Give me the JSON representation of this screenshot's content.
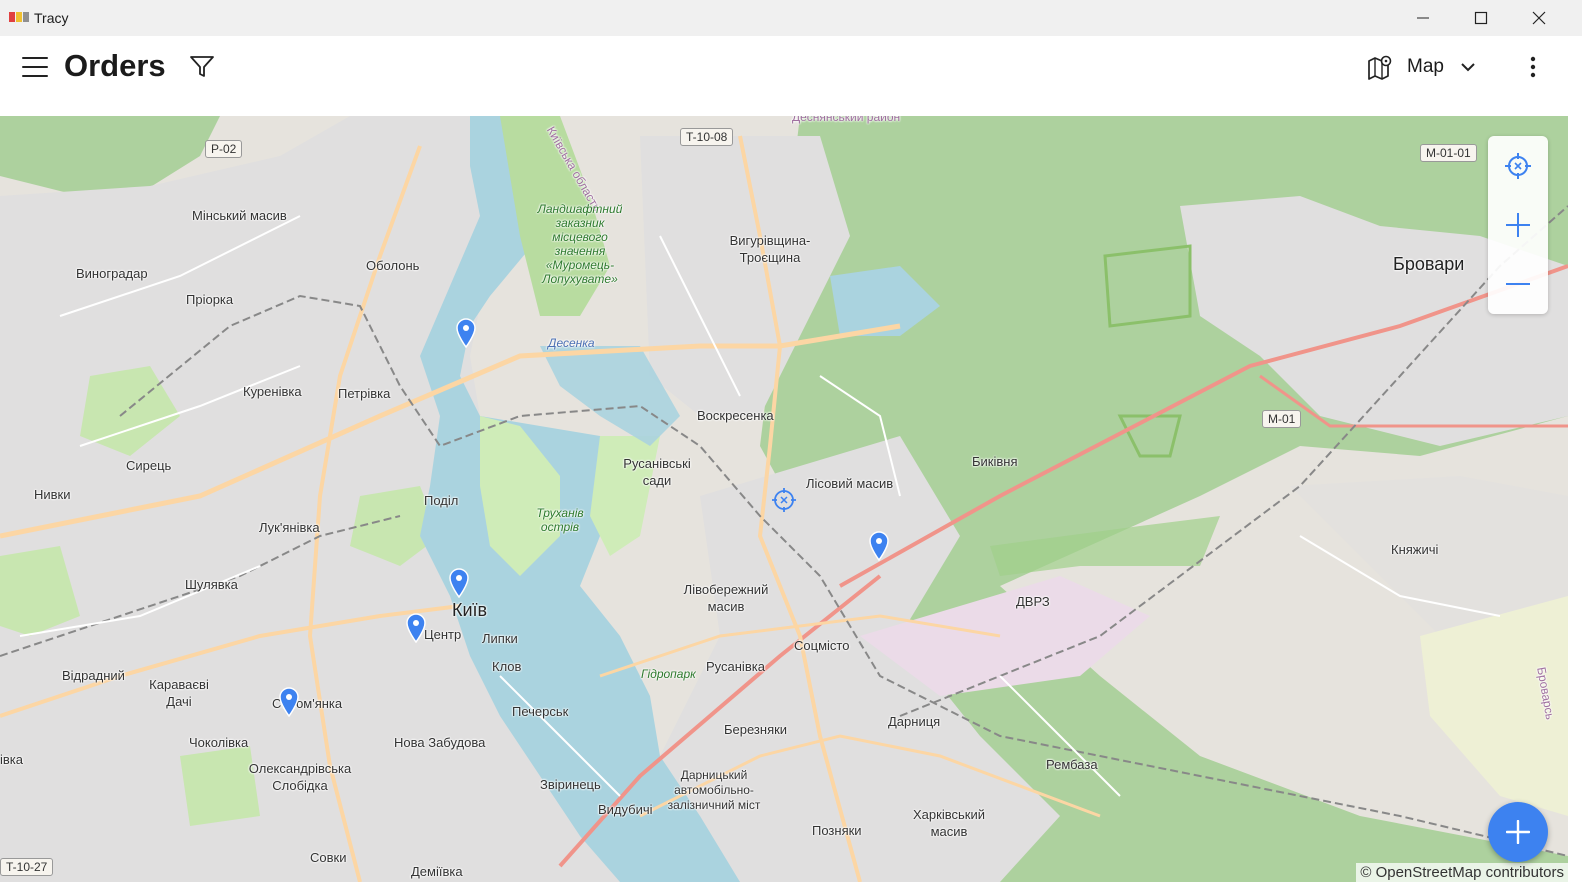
{
  "window": {
    "title": "Tracy"
  },
  "appbar": {
    "title": "Orders",
    "view_label": "Map"
  },
  "map": {
    "attribution": "© OpenStreetMap contributors",
    "labels": {
      "minskyi": "Мінський масив",
      "vynohradar": "Виноградар",
      "obolon": "Оболонь",
      "priorka": "Пріорка",
      "kurenivka": "Куренівка",
      "petrivka": "Петрівка",
      "syrets": "Сирець",
      "nyvky": "Нивки",
      "podil": "Поділ",
      "lukianivka": "Лук'янівка",
      "shuliavka": "Шулявка",
      "kyiv": "Київ",
      "tsentr": "Центр",
      "lypky": "Липки",
      "klov": "Клов",
      "vidradnyi": "Відрадний",
      "karavaievi": "Караваєві Дачі",
      "solomianka": "Солом'янка",
      "chokolivka": "Чоколівка",
      "nova_zabudova": "Нова Забудова",
      "pechersk": "Печерськ",
      "oleksandrivska": "Олександрівська Слобідка",
      "zvirynets": "Звіринець",
      "vydubychi": "Видубичі",
      "sovky": "Совки",
      "demiivka": "Деміївка",
      "vihurivshchyna": "Вигурівщина-Троєщина",
      "voskresenka": "Воскресенка",
      "rusanivski_sady": "Русанівські сади",
      "lisovyi": "Лісовий масив",
      "livoberezhnyi": "Лівобережний масив",
      "rusanivka": "Русанівка",
      "sotsmisto": "Соцмісто",
      "bereznyaky": "Березняки",
      "darnytsia": "Дарниця",
      "pozniaky": "Позняки",
      "kharkivskyi": "Харківський масив",
      "bykivnia": "Биківня",
      "dvrz": "ДВРЗ",
      "rembaza": "Рембаза",
      "brovary": "Бровари",
      "kniazhychi": "Княжичі",
      "rayon": "Деснянський район",
      "ivka": "івка",
      "oblast": "Київська область",
      "zakaznyk": "Ландшафтний заказник місцевого значення «Муромець-Лопухувате»",
      "desenka": "Десенка",
      "trukhaniv": "Труханів острів",
      "hidropark": "Гідропарк",
      "bridge": "Дарницький автомобільно-залізничний міст",
      "brovarsky": "Броварсь"
    },
    "shields": {
      "p02": "P-02",
      "t1008": "T-10-08",
      "m0101": "M-01-01",
      "m01": "M-01",
      "t1027": "T-10-27"
    }
  },
  "colors": {
    "accent": "#3d82f0",
    "pin": "#3d82f0",
    "forest": "#add19e",
    "water": "#aad3df",
    "urban": "#e0dfdf",
    "road_primary": "#fcd6a4",
    "road_trunk": "#f9b29c"
  }
}
